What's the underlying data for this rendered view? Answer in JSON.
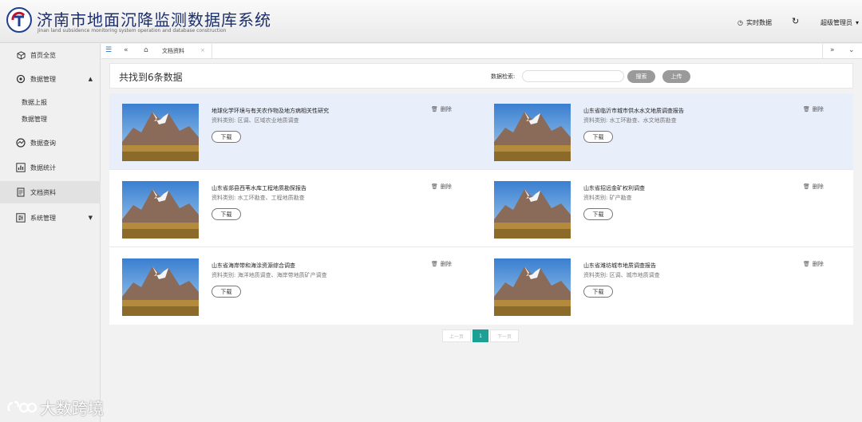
{
  "header": {
    "title": "济南市地面沉降监测数据库系统",
    "subtitle": "Jinan land subsidence monitoring system operation and database construction",
    "realtime_label": "实时数据",
    "user_label": "超级管理员"
  },
  "sidebar": {
    "items": [
      {
        "label": "首页全览"
      },
      {
        "label": "数据管理"
      },
      {
        "label": "数据查询"
      },
      {
        "label": "数据统计"
      },
      {
        "label": "文档资料"
      },
      {
        "label": "系统管理"
      }
    ],
    "sub_items": [
      {
        "label": "数据上报"
      },
      {
        "label": "数据管理"
      }
    ]
  },
  "tabs": {
    "current": "文档资料"
  },
  "results": {
    "count_text": "共找到6条数据",
    "search_label": "数据检索:",
    "search_value": "",
    "search_button": "搜索",
    "upload_button": "上传"
  },
  "documents": [
    {
      "title": "地球化学环境与有关农作物及地方病相关性研究",
      "category": "资料类别:  区调、区域农业地质调查",
      "download": "下载",
      "delete": "删除"
    },
    {
      "title": "山东省临沂市城市供水水文地质调查报告",
      "category": "资料类别:  水工环勘查、水文地质勘查",
      "download": "下载",
      "delete": "删除"
    },
    {
      "title": "山东省郯县西苇水库工程地质勘探报告",
      "category": "资料类别:  水工环勘查、工程地质勘查",
      "download": "下载",
      "delete": "删除"
    },
    {
      "title": "山东省招远金矿权利调查",
      "category": "资料类别:  矿产勘查",
      "download": "下载",
      "delete": "删除"
    },
    {
      "title": "山东省海岸带和海涂资源综合调查",
      "category": "资料类别:  海洋地质调查、海岸带地质矿产调查",
      "download": "下载",
      "delete": "删除"
    },
    {
      "title": "山东省潍坊城市地质调查报告",
      "category": "资料类别:  区调、城市地质调查",
      "download": "下载",
      "delete": "删除"
    }
  ],
  "pagination": {
    "prev": "上一页",
    "current": "1",
    "next": "下一页"
  },
  "watermark": "大数跨境",
  "colors": {
    "brand": "#1d2f6a",
    "accent": "#1aa094",
    "highlight_row": "#e9eefb"
  }
}
